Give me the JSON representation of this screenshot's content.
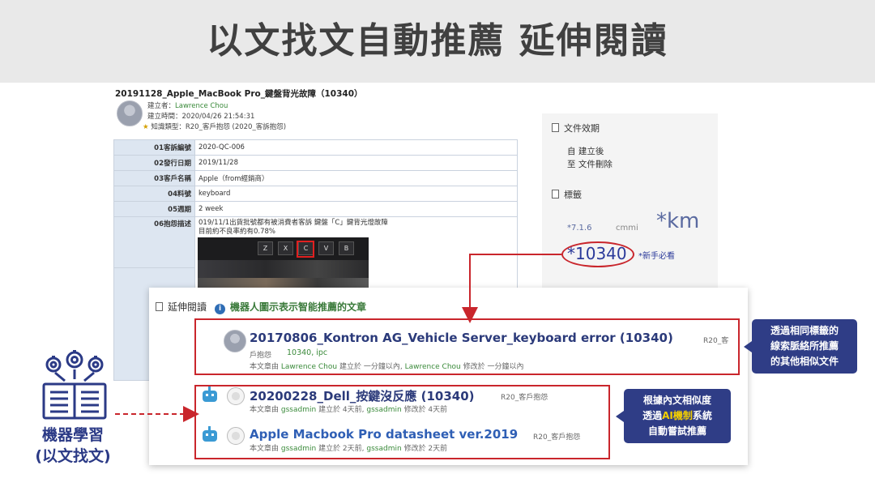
{
  "slide_title": "以文找文自動推薦 延伸閱讀",
  "doc": {
    "title": "20191128_Apple_MacBook Pro_鍵盤背光故障（10340）",
    "creator_label": "建立者：",
    "creator": "Lawrence Chou",
    "created_label": "建立時間：",
    "created": "2020/04/26 21:54:31",
    "kb_type_label": "知識類型：",
    "kb_type": "R20_客戶抱怨 (2020_客訴抱怨)",
    "fields": [
      {
        "label": "01客訴編號",
        "value": "2020-QC-006"
      },
      {
        "label": "02發行日期",
        "value": "2019/11/28"
      },
      {
        "label": "03客戶名稱",
        "value": "Apple（from經銷商）"
      },
      {
        "label": "04料號",
        "value": "keyboard"
      },
      {
        "label": "05週期",
        "value": "2 week"
      },
      {
        "label": "06抱怨描述",
        "value": "019/11/1出貨批號都有被消費者客訴 鍵盤「C」鍵背光燈故障",
        "value2": "目前約不良率約有0.78%"
      }
    ],
    "keys": [
      "Z",
      "X",
      "C",
      "V",
      "B"
    ]
  },
  "side": {
    "validity_heading": "文件效期",
    "validity_from": "自 建立後",
    "validity_to": "至 文件刪除",
    "tags_heading": "標籤",
    "tag1": "*7.1.6",
    "tag2": "cmmi",
    "tag3": "*km",
    "tag_highlight": "*10340",
    "tag_new": "*新手必看"
  },
  "card": {
    "heading": "延伸閱讀",
    "subheading": "機器人圖示表示智能推薦的文章",
    "items": [
      {
        "title": "20170806_Kontron AG_Vehicle Server_keyboard error (10340)",
        "tag": "R20_客",
        "tag_cont": "戶抱怨",
        "keywords": "10340, ipc",
        "meta_pre": "本文章由",
        "author": "Lawrence Chou",
        "created": "建立於 一分鐘以內,",
        "editor": "Lawrence Chou",
        "edited": "修改於 一分鐘以內"
      },
      {
        "title": "20200228_Dell_按鍵沒反應 (10340)",
        "tag": "R20_客戶抱怨",
        "meta_pre": "本文章由",
        "author": "gssadmin",
        "created": "建立於 4天前,",
        "editor": "gssadmin",
        "edited": "修改於 4天前"
      },
      {
        "title": "Apple Macbook Pro datasheet ver.2019",
        "tag": "R20_客戶抱怨",
        "meta_pre": "本文章由",
        "author": "gssadmin",
        "created": "建立於 2天前,",
        "editor": "gssadmin",
        "edited": "修改於 2天前"
      }
    ]
  },
  "callouts": {
    "tag_match": [
      "透過相同標籤的",
      "線索脈絡所推薦",
      "的其他相似文件"
    ],
    "ai_match_l1": "根據內文相似度",
    "ai_match_l2_pre": "透過",
    "ai_match_l2_hl": "AI機制",
    "ai_match_l2_post": "系統",
    "ai_match_l3": "自動嘗試推薦"
  },
  "ml": {
    "label_l1": "機器學習",
    "label_l2": "(以文找文)"
  },
  "colors": {
    "accent_red": "#c9262c",
    "callout_navy": "#2f3d86",
    "highlight_yellow": "#f5d000",
    "link_green": "#3a8a3a",
    "title_band": "#e9e9e9"
  }
}
